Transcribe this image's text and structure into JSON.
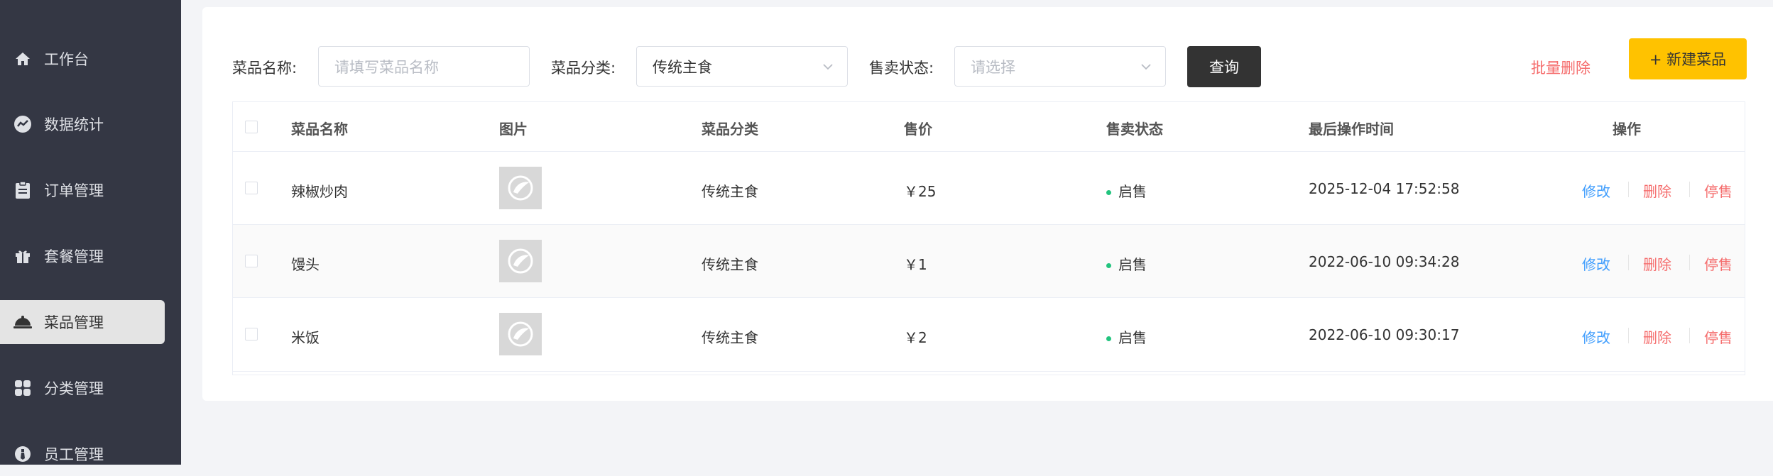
{
  "sidebar": {
    "items": [
      {
        "label": "工作台",
        "icon": "home-icon"
      },
      {
        "label": "数据统计",
        "icon": "chart-icon"
      },
      {
        "label": "订单管理",
        "icon": "clipboard-icon"
      },
      {
        "label": "套餐管理",
        "icon": "gift-icon"
      },
      {
        "label": "菜品管理",
        "icon": "cloche-icon",
        "active": true
      },
      {
        "label": "分类管理",
        "icon": "grid-icon"
      },
      {
        "label": "员工管理",
        "icon": "employee-icon"
      }
    ]
  },
  "filters": {
    "name_label": "菜品名称:",
    "name_placeholder": "请填写菜品名称",
    "category_label": "菜品分类:",
    "category_value": "传统主食",
    "status_label": "售卖状态:",
    "status_placeholder": "请选择",
    "query_label": "查询"
  },
  "actions": {
    "batch_delete": "批量删除",
    "new_dish": "+ 新建菜品"
  },
  "table": {
    "headers": [
      "菜品名称",
      "图片",
      "菜品分类",
      "售价",
      "售卖状态",
      "最后操作时间",
      "操作"
    ],
    "rows": [
      {
        "name": "辣椒炒肉",
        "category": "传统主食",
        "price": "￥25",
        "status": "启售",
        "updated": "2025-12-04 17:52:58"
      },
      {
        "name": "馒头",
        "category": "传统主食",
        "price": "￥1",
        "status": "启售",
        "updated": "2022-06-10 09:34:28"
      },
      {
        "name": "米饭",
        "category": "传统主食",
        "price": "￥2",
        "status": "启售",
        "updated": "2022-06-10 09:30:17"
      }
    ],
    "op_edit": "修改",
    "op_delete": "删除",
    "op_stop": "停售"
  },
  "colors": {
    "sidebar_bg": "#343744",
    "accent_yellow": "#ffc200",
    "danger": "#f56c6c",
    "link_blue": "#419efd",
    "status_green": "#22c47e"
  }
}
